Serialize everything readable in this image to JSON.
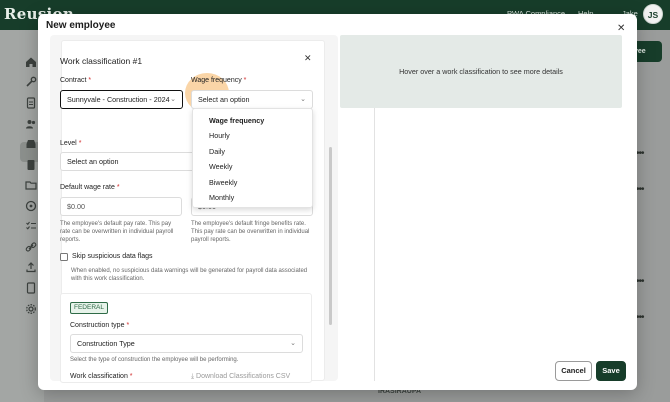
{
  "app": {
    "logo": "Reusion",
    "nav": {
      "compliance": "PWA Compliance",
      "help": "Help",
      "user": "Jake"
    },
    "avatar_initials": "JS",
    "bg_button": "yee",
    "bg_text": "IRASIRAUPA"
  },
  "modal": {
    "title": "New employee",
    "card_title": "Work classification #1",
    "contract": {
      "label": "Contract",
      "value": "Sunnyvale - Construction - 2024"
    },
    "wage_frequency": {
      "label": "Wage frequency",
      "placeholder": "Select an option",
      "options": [
        "Wage frequency",
        "Hourly",
        "Daily",
        "Weekly",
        "Biweekly",
        "Monthly"
      ]
    },
    "level": {
      "label": "Level",
      "placeholder": "Select an option"
    },
    "default_wage_rate": {
      "label": "Default wage rate",
      "placeholder": "$0.00",
      "help": "The employee's default pay rate. This pay rate can be overwritten in individual payroll reports."
    },
    "fringe_rate": {
      "placeholder": "$0.00",
      "help": "The employee's default fringe benefits rate. This pay rate can be overwritten in individual payroll reports."
    },
    "skip_flags": {
      "label": "Skip suspicious data flags",
      "help": "When enabled, no suspicious data warnings will be generated for payroll data associated with this work classification."
    },
    "federal_badge": "FEDERAL",
    "construction_type": {
      "label": "Construction type",
      "value": "Construction Type",
      "help": "Select the type of construction the employee will be performing."
    },
    "work_classification": {
      "label": "Work classification"
    },
    "download_csv": "Download Classifications CSV",
    "info_text": "Hover over a work classification to see more details",
    "cancel": "Cancel",
    "save": "Save",
    "required_mark": "*"
  }
}
